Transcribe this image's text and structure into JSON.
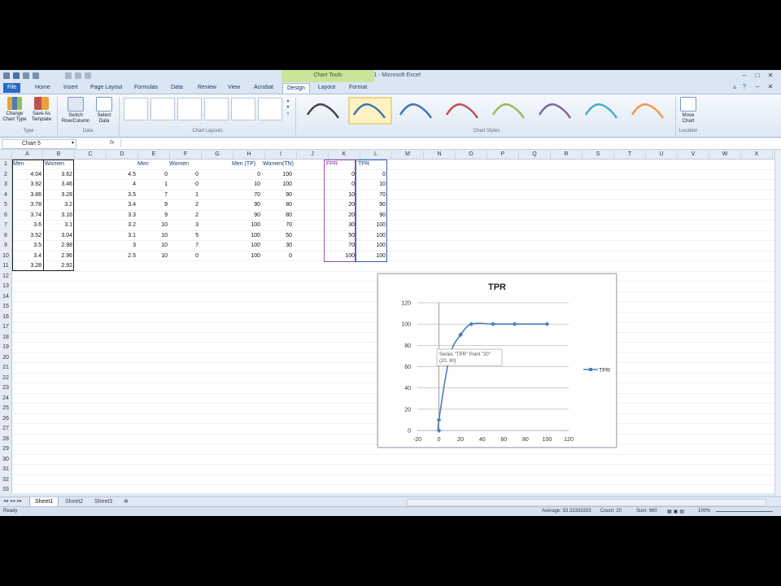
{
  "window": {
    "title": "Book1 - Microsoft Excel",
    "context_tab_group": "Chart Tools"
  },
  "tabs": [
    "File",
    "Home",
    "Insert",
    "Page Layout",
    "Formulas",
    "Data",
    "Review",
    "View",
    "Acrobat",
    "Design",
    "Layout",
    "Format"
  ],
  "active_tab": "Design",
  "ribbon": {
    "type_group": {
      "name": "Type",
      "change_chart_type": "Change Chart Type",
      "save_as_template": "Save As Template"
    },
    "data_group": {
      "name": "Data",
      "switch_row_column": "Switch Row/Column",
      "select_data": "Select Data"
    },
    "chart_layouts_name": "Chart Layouts",
    "chart_styles_name": "Chart Styles",
    "location_group": {
      "name": "Location",
      "move_chart": "Move Chart"
    },
    "style_colors": [
      "#444444",
      "#3f76b5",
      "#3f76b5",
      "#c0504d",
      "#9bbb59",
      "#8064a2",
      "#4bacc6",
      "#f79646"
    ]
  },
  "formula_bar": {
    "name_box": "Chart 5",
    "fx": "fx",
    "value": ""
  },
  "columns": [
    "A",
    "B",
    "C",
    "D",
    "E",
    "F",
    "G",
    "H",
    "I",
    "J",
    "K",
    "L",
    "M",
    "N",
    "O",
    "P",
    "Q",
    "R",
    "S",
    "T",
    "U",
    "V",
    "W",
    "X"
  ],
  "rows": [
    "1",
    "2",
    "3",
    "4",
    "5",
    "6",
    "7",
    "8",
    "9",
    "10",
    "11",
    "12",
    "13",
    "14",
    "15",
    "16",
    "17",
    "18",
    "19",
    "20",
    "21",
    "22",
    "23",
    "24",
    "25",
    "26",
    "27",
    "28",
    "29",
    "30",
    "31",
    "32",
    "33"
  ],
  "table_ab": {
    "headers": [
      "Men",
      "Women"
    ],
    "rows": [
      [
        "4.04",
        "3.62"
      ],
      [
        "3.92",
        "3.46"
      ],
      [
        "3.86",
        "3.28"
      ],
      [
        "3.78",
        "3.2"
      ],
      [
        "3.74",
        "3.16"
      ],
      [
        "3.6",
        "3.1"
      ],
      [
        "3.52",
        "3.04"
      ],
      [
        "3.5",
        "2.98"
      ],
      [
        "3.4",
        "2.96"
      ],
      [
        "3.28",
        "2.92"
      ]
    ]
  },
  "table_def": {
    "headers": [
      "Men",
      "Women"
    ],
    "rows": [
      [
        "4.5",
        "0",
        "0"
      ],
      [
        "4",
        "1",
        "0"
      ],
      [
        "3.5",
        "7",
        "1"
      ],
      [
        "3.4",
        "9",
        "2"
      ],
      [
        "3.3",
        "9",
        "2"
      ],
      [
        "3.2",
        "10",
        "3"
      ],
      [
        "3.1",
        "10",
        "5"
      ],
      [
        "3",
        "10",
        "7"
      ],
      [
        "2.5",
        "10",
        "0"
      ]
    ]
  },
  "table_hi": {
    "headers": [
      "Men (TP)",
      "Women(TN)"
    ],
    "rows": [
      [
        "0",
        "100"
      ],
      [
        "10",
        "100"
      ],
      [
        "70",
        "90"
      ],
      [
        "90",
        "80"
      ],
      [
        "90",
        "80"
      ],
      [
        "100",
        "70"
      ],
      [
        "100",
        "50"
      ],
      [
        "100",
        "30"
      ],
      [
        "100",
        "0"
      ]
    ]
  },
  "table_kl": {
    "headers": [
      "FPR",
      "TPR"
    ],
    "rows": [
      [
        "0",
        "0"
      ],
      [
        "0",
        "10"
      ],
      [
        "10",
        "70"
      ],
      [
        "20",
        "90"
      ],
      [
        "20",
        "90"
      ],
      [
        "30",
        "100"
      ],
      [
        "50",
        "100"
      ],
      [
        "70",
        "100"
      ],
      [
        "100",
        "100"
      ]
    ]
  },
  "chart_data": {
    "type": "scatter",
    "title": "TPR",
    "series": [
      {
        "name": "TPR",
        "color": "#4a7ebb",
        "x": [
          0,
          0,
          10,
          20,
          20,
          30,
          50,
          70,
          100
        ],
        "y": [
          0,
          10,
          70,
          90,
          90,
          100,
          100,
          100,
          100
        ]
      }
    ],
    "xlim": [
      -20,
      120
    ],
    "ylim": [
      0,
      120
    ],
    "x_ticks": [
      "-20",
      "0",
      "20",
      "40",
      "60",
      "80",
      "100",
      "120"
    ],
    "y_ticks": [
      "0",
      "20",
      "40",
      "60",
      "80",
      "100",
      "120"
    ],
    "grid": "horizontal",
    "legend_position": "right",
    "tooltip": {
      "line1": "Series \"TPR\" Point \"20\"",
      "line2": "(20, 90)"
    }
  },
  "sheets": [
    "Sheet1",
    "Sheet2",
    "Sheet3"
  ],
  "active_sheet": "Sheet1",
  "status": {
    "mode": "Ready",
    "average": "Average: 53.33333333",
    "count": "Count: 20",
    "sum": "Sum: 960",
    "zoom": "100%"
  }
}
